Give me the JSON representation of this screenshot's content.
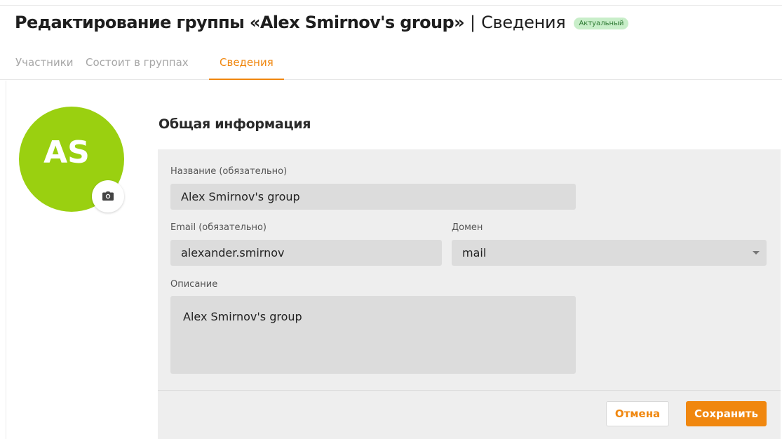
{
  "header": {
    "title": "Редактирование группы «Alex Smirnov's group»",
    "separator": "|",
    "section": "Сведения",
    "status": "Актуальный"
  },
  "tabs": [
    {
      "label": "Участники",
      "active": false
    },
    {
      "label": "Состоит в группах",
      "active": false
    },
    {
      "label": "Сведения",
      "active": true
    }
  ],
  "avatar": {
    "initials": "AS",
    "color": "#9ad010",
    "camera_icon": "camera-icon"
  },
  "form": {
    "section_title": "Общая информация",
    "name": {
      "label": "Название (обязательно)",
      "value": "Alex Smirnov's group"
    },
    "email": {
      "label": "Email (обязательно)",
      "value": "alexander.smirnov"
    },
    "domain": {
      "label": "Домен",
      "value": "mail"
    },
    "description": {
      "label": "Описание",
      "value": "Alex Smirnov's group"
    }
  },
  "actions": {
    "cancel_label": "Отмена",
    "save_label": "Сохранить"
  },
  "colors": {
    "accent": "#f0870f",
    "status_bg": "#c8eec9",
    "status_text": "#2f7a34"
  }
}
